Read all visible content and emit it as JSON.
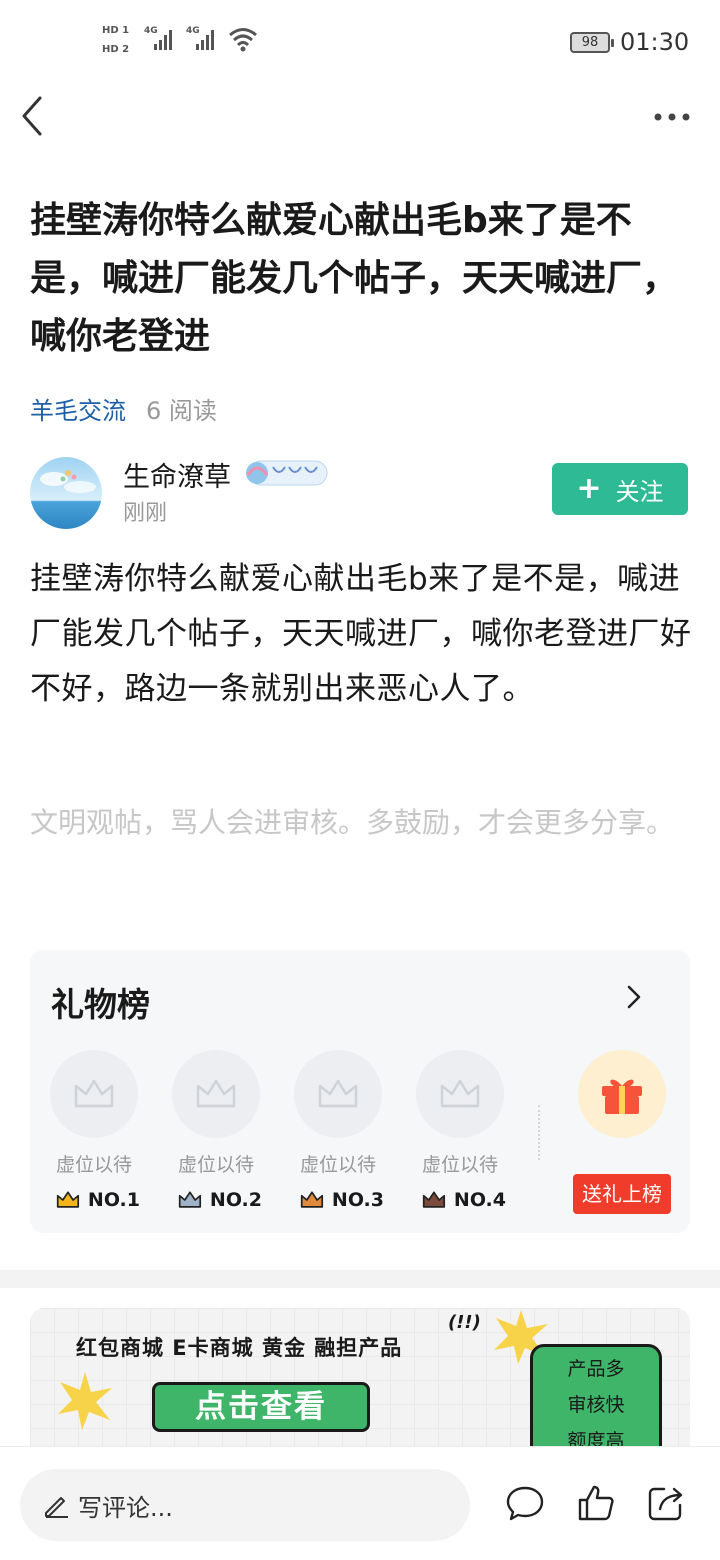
{
  "status_bar": {
    "hd1": "HD 1",
    "hd2": "HD 2",
    "net1": "4G",
    "net2": "4G",
    "battery": "98",
    "time": "01:30"
  },
  "nav": {
    "back_icon": "back-chevron-icon",
    "more_icon": "more-dots-icon"
  },
  "article": {
    "title": "挂壁涛你特么献爱心献出毛b来了是不是，喊进厂能发几个帖子，天天喊进厂，喊你老登进",
    "category": "羊毛交流",
    "read_count": "6 阅读",
    "author": {
      "name": "生命潦草",
      "time": "刚刚",
      "follow_label": "关注"
    },
    "body": "挂壁涛你特么献爱心献出毛b来了是不是，喊进厂能发几个帖子，天天喊进厂，喊你老登进厂好不好，路边一条就别出来恶心人了。",
    "notice": "文明观帖，骂人会进审核。多鼓励，才会更多分享。"
  },
  "gift_board": {
    "title": "礼物榜",
    "slots": [
      {
        "label": "虚位以待",
        "rank": "NO.1",
        "crown_color": "#f2b61c"
      },
      {
        "label": "虚位以待",
        "rank": "NO.2",
        "crown_color": "#9fb3c8"
      },
      {
        "label": "虚位以待",
        "rank": "NO.3",
        "crown_color": "#e08a3c"
      },
      {
        "label": "虚位以待",
        "rank": "NO.4",
        "crown_color": "#7a4a3a"
      }
    ],
    "send_label": "送礼上榜"
  },
  "ad": {
    "tagline": "红包商城  E卡商城  黄金  融担产品",
    "exclaim": "(!!)",
    "cta": "点击查看",
    "features": [
      "产品多",
      "审核快",
      "额度高"
    ]
  },
  "bottom_bar": {
    "comment_placeholder": "写评论..."
  },
  "colors": {
    "accent": "#2dba95",
    "link": "#1f5fa6",
    "gift_red": "#f03c2a",
    "ad_green": "#3fb56a"
  }
}
